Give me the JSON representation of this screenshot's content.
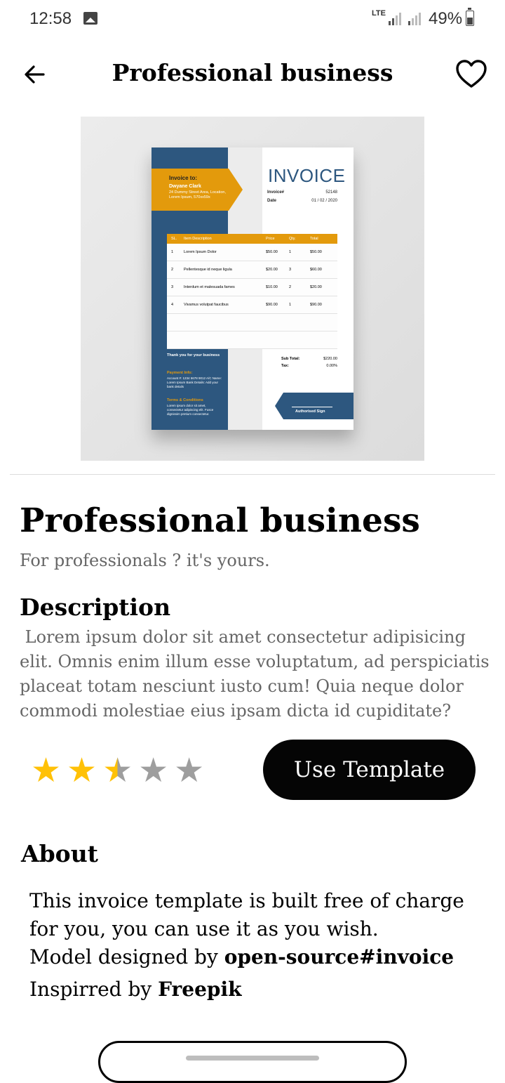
{
  "status_bar": {
    "time": "12:58",
    "network": "LTE",
    "battery": "49%"
  },
  "topbar": {
    "title": "Professional business",
    "back_icon": "arrow-left-icon",
    "favorite_icon": "heart-outline-icon"
  },
  "preview": {
    "invoice_to": "Invoice to:",
    "name": "Dwyane Clark",
    "address": "24 Dummy Street Area, Location, Lorem Ipsum, 570xx59x",
    "heading": "INVOICE",
    "invoice_label": "Invoice#",
    "invoice_no": "52148",
    "date_label": "Date",
    "date": "01 / 02 / 2020",
    "columns": [
      "SL.",
      "Item Description",
      "Price",
      "Qty.",
      "Total"
    ],
    "rows": [
      [
        "1",
        "Lorem Ipsum Dolor",
        "$50.00",
        "1",
        "$50.00"
      ],
      [
        "2",
        "Pellentesque id neque ligula",
        "$20.00",
        "3",
        "$60.00"
      ],
      [
        "3",
        "Interdum et malesuada fames",
        "$10.00",
        "2",
        "$20.00"
      ],
      [
        "4",
        "Vivamus volutpat faucibus",
        "$90.00",
        "1",
        "$90.00"
      ],
      [
        "",
        "",
        "",
        "",
        ""
      ],
      [
        "",
        "",
        "",
        "",
        ""
      ]
    ],
    "thanks": "Thank you for your business",
    "payment_title": "Payment Info:",
    "payment_details": "Account #: 1234 5678 9012   A/C Name: Lorem Ipsum   Bank Details: Add your bank details",
    "terms_title": "Terms & Conditions",
    "terms_text": "Lorem ipsum dolor sit amet, consectetur adipiscing elit. Fusce dignissim pretium consectetur.",
    "subtotal_label": "Sub Total:",
    "subtotal": "$220.00",
    "tax_label": "Tax:",
    "tax": "0.00%",
    "sign": "Authorised Sign"
  },
  "main": {
    "title": "Professional business",
    "subtitle": "For professionals ? it's yours.",
    "description_heading": "Description",
    "description": " Lorem ipsum dolor sit amet consectetur adipisicing elit. Omnis enim illum esse voluptatum, ad perspiciatis placeat totam nesciunt iusto cum! Quia neque dolor commodi molestiae eius ipsam dicta id cupiditate?",
    "rating": 2.5,
    "rating_max": 5,
    "use_button": "Use Template"
  },
  "about": {
    "heading": "About",
    "line1": "This invoice template is built free of charge for you, you can use it as you wish.",
    "model_prefix": "Model designed by ",
    "model_link": "open-source#invoice",
    "inspired_prefix": "Inspirred by ",
    "inspired_link": "Freepik"
  },
  "colors": {
    "star_filled": "#FFC107",
    "star_empty": "#9E9E9E",
    "button_bg": "#050505",
    "invoice_blue": "#2d577f",
    "invoice_orange": "#e39a0c"
  }
}
